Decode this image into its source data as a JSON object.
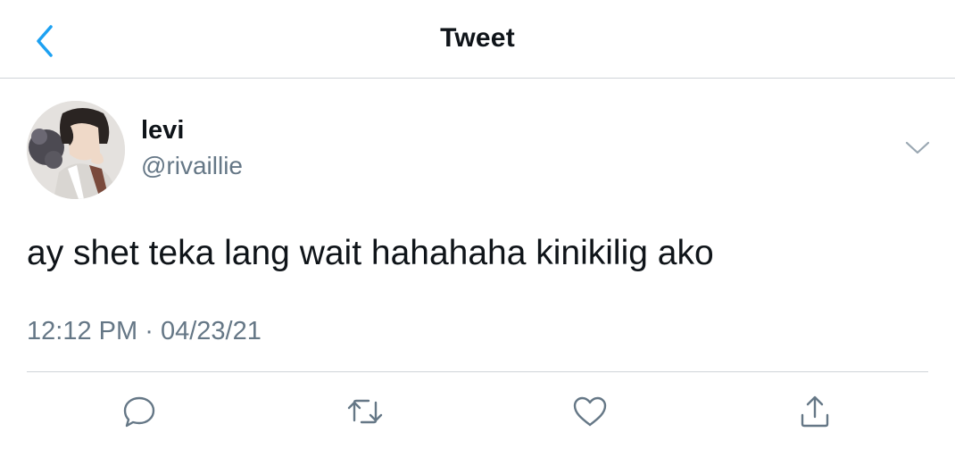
{
  "header": {
    "title": "Tweet",
    "back_icon": "chevron-left-icon",
    "accent_color": "#1da1f2"
  },
  "tweet": {
    "author": {
      "display_name": "levi",
      "handle": "@rivaillie",
      "avatar_icon": "avatar-image"
    },
    "text": "ay shet teka lang wait hahahaha kinikilig ako",
    "time": "12:12 PM",
    "separator": "·",
    "date": "04/23/21",
    "more_icon": "chevron-down-icon"
  },
  "actions": [
    {
      "name": "reply",
      "icon": "comment-icon"
    },
    {
      "name": "retweet",
      "icon": "retweet-icon"
    },
    {
      "name": "like",
      "icon": "heart-icon"
    },
    {
      "name": "share",
      "icon": "share-icon"
    }
  ],
  "colors": {
    "text": "#0f1419",
    "secondary": "#657786",
    "divider": "#cfd4d8"
  }
}
